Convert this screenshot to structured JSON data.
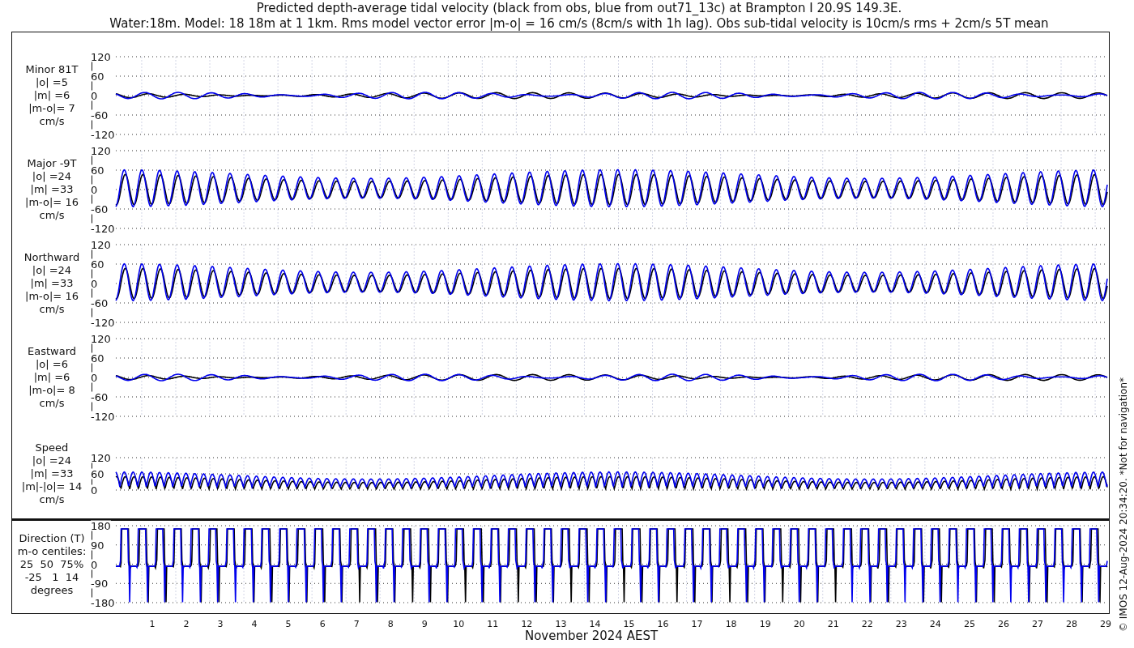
{
  "title": "Predicted depth-average tidal velocity (black from obs, blue from out71_13c) at Brampton I 20.9S 149.3E.",
  "subtitle": "Water:18m. Model: 18 18m at 1 1km. Rms model vector error |m-o| = 16 cm/s (8cm/s with 1h lag). Obs sub-tidal velocity is 10cm/s rms + 2cm/s 5T mean",
  "panels": [
    {
      "kind": "minor",
      "label_lines": [
        "Minor 81T",
        "|o| =5",
        "|m| =6",
        "|m-o|= 7",
        "cm/s"
      ],
      "yticks": [
        "120",
        "60",
        "0",
        "-60",
        "-120"
      ]
    },
    {
      "kind": "tidal",
      "label_lines": [
        "Major -9T",
        "|o| =24",
        "|m| =33",
        "|m-o|= 16",
        "cm/s"
      ],
      "yticks": [
        "120",
        "60",
        "0",
        "-60",
        "-120"
      ]
    },
    {
      "kind": "tidal",
      "label_lines": [
        "Northward",
        "|o| =24",
        "|m| =33",
        "|m-o|= 16",
        "cm/s"
      ],
      "yticks": [
        "120",
        "60",
        "0",
        "-60",
        "-120"
      ]
    },
    {
      "kind": "minor",
      "label_lines": [
        "Eastward",
        "|o| =6",
        "|m| =6",
        "|m-o|= 8",
        "cm/s"
      ],
      "yticks": [
        "120",
        "60",
        "0",
        "-60",
        "-120"
      ]
    },
    {
      "kind": "speed",
      "label_lines": [
        "Speed",
        "|o| =24",
        "|m| =33",
        "|m|-|o|= 14",
        "cm/s"
      ],
      "yticks": [
        "120",
        "60",
        "0"
      ]
    },
    {
      "kind": "direction",
      "label_lines": [
        "Direction (T)",
        "m-o centiles:",
        "25  50  75%",
        "-25   1  14",
        "degrees"
      ],
      "yticks": [
        "180",
        "90",
        "0",
        "-90",
        "-180"
      ]
    }
  ],
  "days": [
    "1",
    "2",
    "3",
    "4",
    "5",
    "6",
    "7",
    "8",
    "9",
    "10",
    "11",
    "12",
    "13",
    "14",
    "15",
    "16",
    "17",
    "18",
    "19",
    "20",
    "21",
    "22",
    "23",
    "24",
    "25",
    "26",
    "27",
    "28",
    "29"
  ],
  "xlabel": "November 2024 AEST",
  "credit": "© IMOS 12-Aug-2024 20:34:20. *Not for navigation*"
}
